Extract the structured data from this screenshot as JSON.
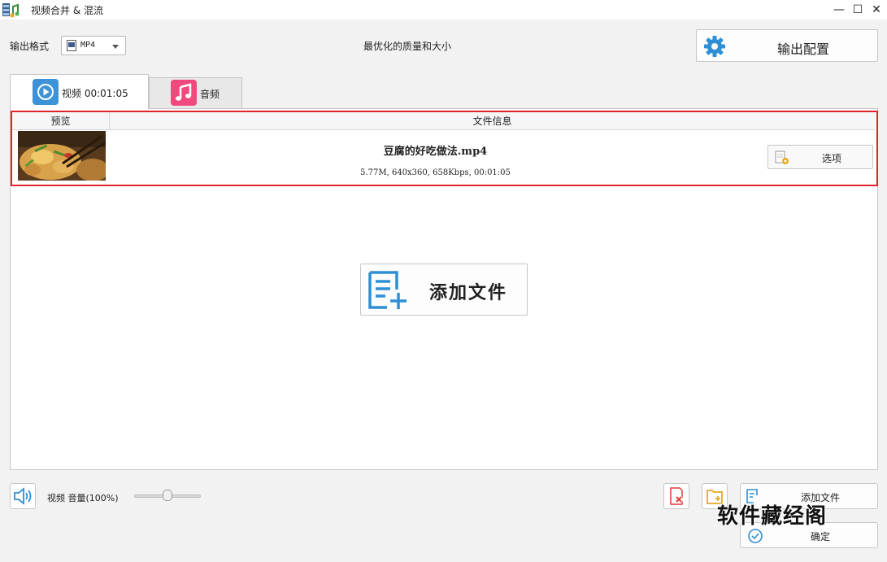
{
  "window": {
    "title": "视频合并 & 混流",
    "minimize_glyph": "—",
    "maximize_glyph": "☐",
    "close_glyph": "✕"
  },
  "toolbar": {
    "format_label": "输出格式",
    "format_value": "MP4",
    "quality_text": "最优化的质量和大小",
    "config_button": "输出配置"
  },
  "tabs": [
    {
      "label": "视频 00:01:05",
      "icon": "play-circle-icon",
      "active": true,
      "color": "#3e93d8"
    },
    {
      "label": "音频",
      "icon": "music-note-icon",
      "active": false,
      "color": "#f1487e"
    }
  ],
  "table": {
    "columns": [
      "预览",
      "文件信息"
    ],
    "rows": [
      {
        "name": "豆腐的好吃做法.mp4",
        "meta": "5.77M, 640x360, 658Kbps, 00:01:05",
        "options_button": "选项"
      }
    ]
  },
  "add_files_big": "添加文件",
  "bottom": {
    "volume_label": "视频 音量(100%)",
    "volume_percent": 100,
    "add_files": "添加文件",
    "ok": "确定"
  },
  "watermark": "软件藏经阁",
  "colors": {
    "accent_blue": "#2f8fd6",
    "highlight_red": "#e0242a",
    "music_pink": "#f1487e",
    "delete_red": "#e23b3b",
    "folder_yellow": "#e8a81c"
  }
}
